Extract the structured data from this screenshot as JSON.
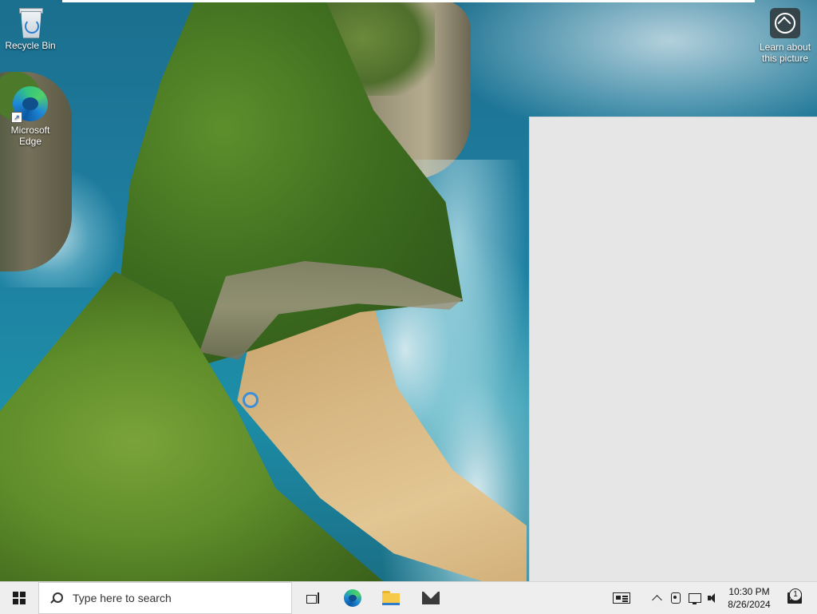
{
  "desktop": {
    "icons": [
      {
        "label": "Recycle Bin",
        "icon": "recycle-bin-icon"
      },
      {
        "label": "Microsoft Edge",
        "icon": "edge-icon"
      },
      {
        "label": "Learn about this picture",
        "icon": "learn-about-picture-icon"
      }
    ]
  },
  "taskbar": {
    "search_placeholder": "Type here to search",
    "pinned": [
      {
        "icon": "task-view-icon"
      },
      {
        "icon": "edge-icon"
      },
      {
        "icon": "file-explorer-icon"
      },
      {
        "icon": "mail-icon"
      }
    ],
    "tray": {
      "icons": [
        "news-and-interests-icon",
        "chevron-up-icon",
        "meet-now-icon",
        "network-icon",
        "volume-icon"
      ],
      "time": "10:30 PM",
      "date": "8/26/2024",
      "notification_count": "1"
    }
  },
  "colors": {
    "taskbar_bg": "#eeeeee",
    "blank_window_bg": "#e6e6e6",
    "cursor_accent": "#3c8fd6"
  }
}
